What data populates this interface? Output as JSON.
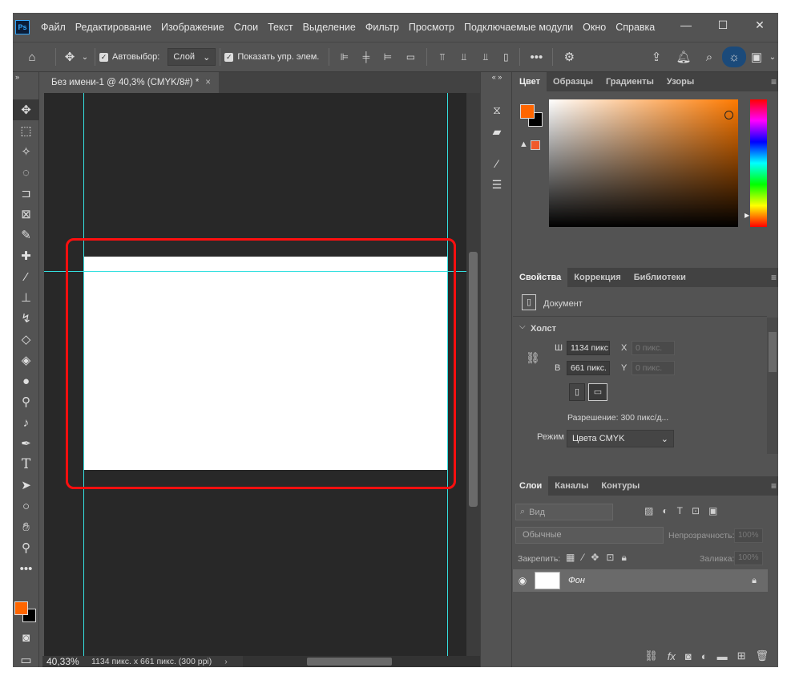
{
  "app": {
    "logo": "Ps"
  },
  "menu": [
    "Файл",
    "Редактирование",
    "Изображение",
    "Слои",
    "Текст",
    "Выделение",
    "Фильтр",
    "Просмотр",
    "Подключаемые модули",
    "Окно",
    "Справка"
  ],
  "window_controls": {
    "minimize": "—",
    "maximize": "☐",
    "close": "✕"
  },
  "options": {
    "autoselect_label": "Автовыбор:",
    "autoselect_value": "Слой",
    "show_transform_label": "Показать упр. элем."
  },
  "document": {
    "tab_title": "Без имени-1 @ 40,3% (CMYK/8#) *",
    "close": "×"
  },
  "status": {
    "zoom": "40,33%",
    "doc_info": "1134 пикс. x 661 пикс. (300 ppi)"
  },
  "color_panel": {
    "tabs": [
      "Цвет",
      "Образцы",
      "Градиенты",
      "Узоры"
    ],
    "fg_color": "#ff6600",
    "bg_color": "#000000"
  },
  "properties_panel": {
    "tabs": [
      "Свойства",
      "Коррекция",
      "Библиотеки"
    ],
    "doc_label": "Документ",
    "section": "Холст",
    "w_label": "Ш",
    "w_value": "1134 пикс",
    "x_label": "X",
    "x_placeholder": "0 пикс.",
    "h_label": "В",
    "h_value": "661 пикс.",
    "y_label": "Y",
    "y_placeholder": "0 пикс.",
    "resolution": "Разрешение: 300 пикс/д...",
    "mode_label": "Режим",
    "mode_value": "Цвета CMYK"
  },
  "layers_panel": {
    "tabs": [
      "Слои",
      "Каналы",
      "Контуры"
    ],
    "search_placeholder": "Вид",
    "blend_mode": "Обычные",
    "opacity_label": "Непрозрачность:",
    "opacity_value": "100%",
    "lock_label": "Закрепить:",
    "fill_label": "Заливка:",
    "fill_value": "100%",
    "layers": [
      {
        "name": "Фон"
      }
    ]
  }
}
